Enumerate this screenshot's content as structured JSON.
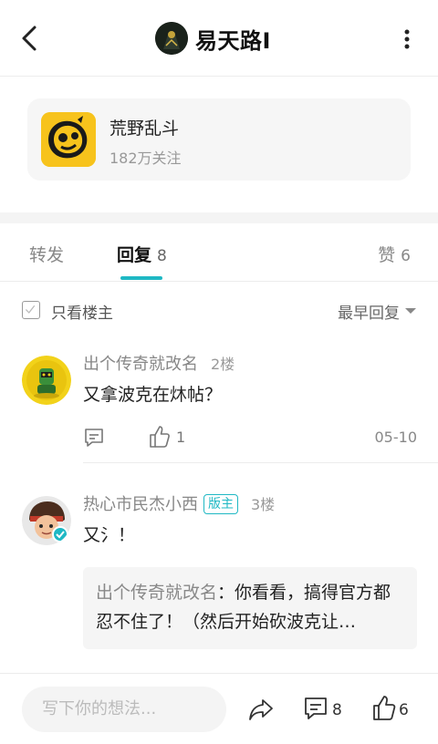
{
  "header": {
    "title": "易天路I"
  },
  "game": {
    "name": "荒野乱斗",
    "followers": "182万关注"
  },
  "tabs": {
    "forward": "转发",
    "reply": "回复",
    "reply_count": "8",
    "like": "赞",
    "like_count": "6"
  },
  "filter": {
    "only_owner": "只看楼主",
    "sort": "最早回复"
  },
  "replies": [
    {
      "name": "出个传奇就改名",
      "floor": "2楼",
      "text": "又拿波克在炑帖？",
      "like_count": "1",
      "date": "05-10"
    },
    {
      "name": "热心市民杰小西",
      "badge": "版主",
      "floor": "3楼",
      "text": "又氵！",
      "quote_name": "出个传奇就改名",
      "quote_sep": "：",
      "quote_text": "你看看，搞得官方都忍不住了！（然后开始砍波克让…"
    }
  ],
  "bottom": {
    "placeholder": "写下你的想法...",
    "comment_count": "8",
    "like_count": "6"
  },
  "colors": {
    "accent": "#1fb8c4"
  }
}
